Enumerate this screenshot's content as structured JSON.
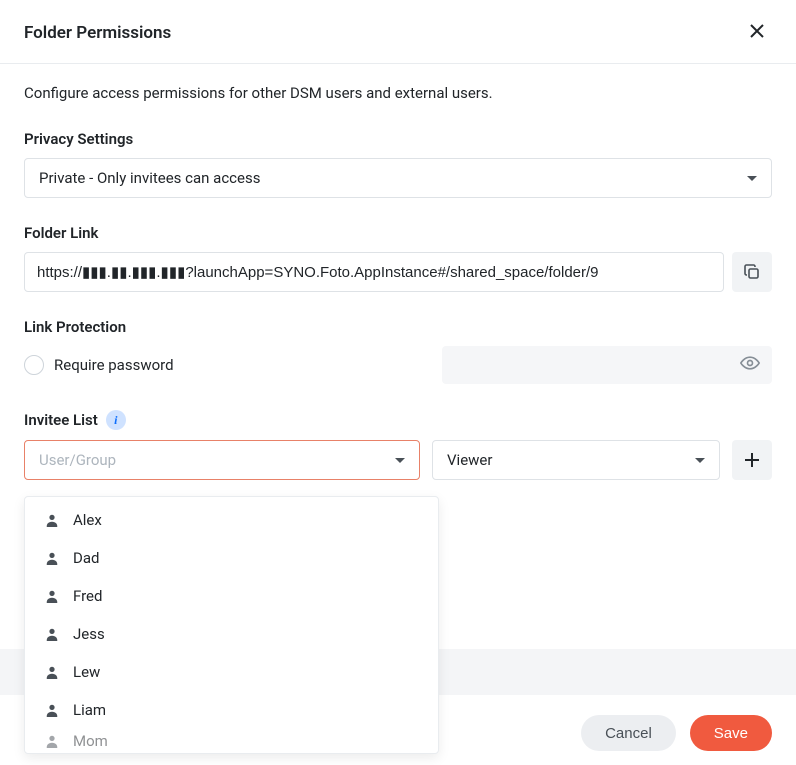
{
  "header": {
    "title": "Folder Permissions"
  },
  "description": "Configure access permissions for other DSM users and external users.",
  "privacy": {
    "label": "Privacy Settings",
    "value": "Private - Only invitees can access"
  },
  "folder_link": {
    "label": "Folder Link",
    "value": "https://▮▮▮.▮▮.▮▮▮.▮▮▮?launchApp=SYNO.Foto.AppInstance#/shared_space/folder/9"
  },
  "link_protection": {
    "label": "Link Protection",
    "require_password_label": "Require password",
    "password_value": ""
  },
  "invitee": {
    "label": "Invitee List",
    "user_placeholder": "User/Group",
    "role_value": "Viewer",
    "options": [
      "Alex",
      "Dad",
      "Fred",
      "Jess",
      "Lew",
      "Liam",
      "Mom"
    ]
  },
  "footer": {
    "cancel": "Cancel",
    "save": "Save"
  }
}
